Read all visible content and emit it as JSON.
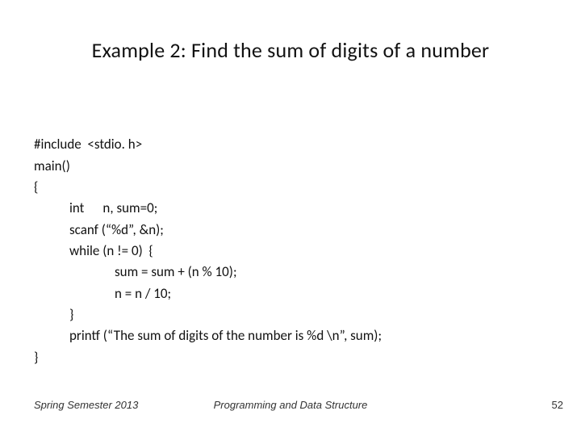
{
  "title": "Example 2: Find the sum of digits of a number",
  "code": {
    "l1": "#include  <stdio. h>",
    "l2": "main()",
    "l3": "{",
    "l4": "int      n, sum=0;",
    "l5": "scanf (“%d”, &n);",
    "l6": "while (n != 0)  {",
    "l7": "sum = sum + (n % 10);",
    "l8": "n = n / 10;",
    "l9": "}",
    "l10": "printf (“The sum of digits of the number is %d \\n”, sum);",
    "l11": "}"
  },
  "footer": {
    "left": "Spring Semester 2013",
    "center": "Programming and Data Structure",
    "right": "52"
  }
}
